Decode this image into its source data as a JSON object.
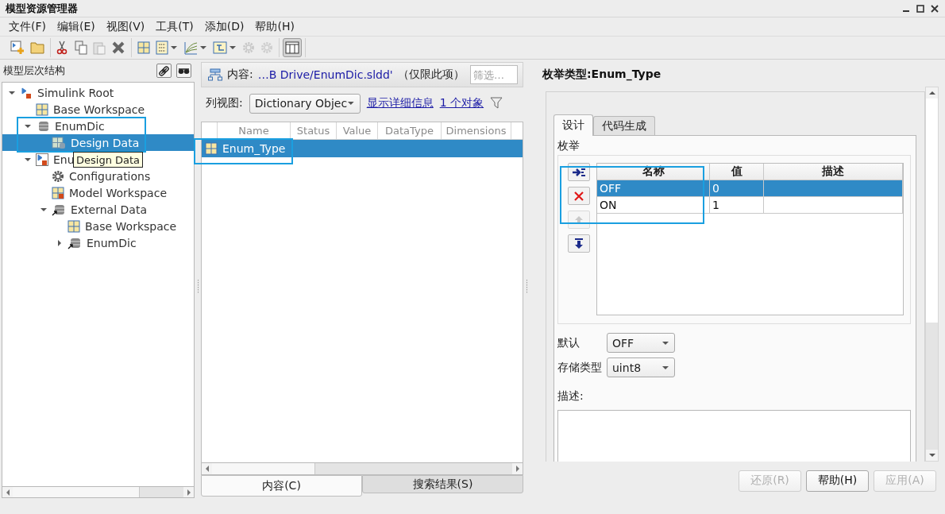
{
  "window": {
    "title": "模型资源管理器"
  },
  "menu": [
    {
      "label": "文件(F)"
    },
    {
      "label": "编辑(E)"
    },
    {
      "label": "视图(V)"
    },
    {
      "label": "工具(T)"
    },
    {
      "label": "添加(D)"
    },
    {
      "label": "帮助(H)"
    }
  ],
  "toolbar": [
    [
      {
        "disabled": false,
        "dropdown": false,
        "pressed": false
      },
      {
        "disabled": false,
        "dropdown": false,
        "pressed": false
      }
    ],
    [
      {
        "disabled": false,
        "dropdown": false,
        "pressed": false
      },
      {
        "disabled": false,
        "dropdown": false,
        "pressed": false
      },
      {
        "disabled": true,
        "dropdown": false,
        "pressed": false
      },
      {
        "disabled": false,
        "dropdown": false,
        "pressed": false
      }
    ],
    [
      {
        "disabled": false,
        "dropdown": false,
        "pressed": false
      },
      {
        "disabled": false,
        "dropdown": true,
        "pressed": false
      },
      {
        "disabled": false,
        "dropdown": true,
        "pressed": false
      },
      {
        "disabled": false,
        "dropdown": true,
        "pressed": false
      },
      {
        "disabled": true,
        "dropdown": false,
        "pressed": false
      },
      {
        "disabled": true,
        "dropdown": false,
        "pressed": false
      }
    ],
    [
      {
        "disabled": false,
        "dropdown": false,
        "pressed": true
      }
    ]
  ],
  "hierarchy": {
    "title": "模型层次结构",
    "tree": [
      {
        "label": "Simulink Root",
        "kind": "root",
        "expanded": true,
        "selected": false,
        "children": [
          {
            "label": "Base Workspace",
            "kind": "workspace",
            "selected": false
          },
          {
            "label": "EnumDic",
            "kind": "dictionary",
            "expanded": true,
            "selected": false,
            "children": [
              {
                "label": "Design Data",
                "kind": "design-data",
                "selected": true
              }
            ]
          },
          {
            "label": "Enu",
            "kind": "model",
            "expanded": true,
            "selected": false,
            "children": [
              {
                "label": "Configurations",
                "kind": "config",
                "selected": false
              },
              {
                "label": "Model Workspace",
                "kind": "model-workspace",
                "selected": false
              },
              {
                "label": "External Data",
                "kind": "external",
                "expanded": true,
                "selected": false,
                "children": [
                  {
                    "label": "Base Workspace",
                    "kind": "workspace",
                    "selected": false
                  },
                  {
                    "label": "EnumDic",
                    "kind": "external",
                    "expanded": false,
                    "selected": false
                  }
                ]
              }
            ]
          }
        ]
      }
    ],
    "tooltip": "Design Data"
  },
  "contents": {
    "label": "内容:",
    "path": "…B Drive/EnumDic.sldd'",
    "scope": "（仅限此项）",
    "filter": {
      "placeholder": "筛选…"
    },
    "view_label": "列视图:",
    "view": "Dictionary Objec",
    "details_link": "显示详细信息",
    "count_link": "1 个对象",
    "columns": [
      "Name",
      "Status",
      "Value",
      "DataType",
      "Dimensions"
    ],
    "rows": [
      {
        "name": "Enum_Type",
        "selected": true
      }
    ],
    "tabs": [
      {
        "label": "内容(C)",
        "selected": true
      },
      {
        "label": "搜索结果(S)",
        "selected": false
      }
    ]
  },
  "editor": {
    "title": "枚举类型:Enum_Type",
    "tabs": [
      {
        "label": "设计",
        "selected": true
      },
      {
        "label": "代码生成",
        "selected": false
      }
    ],
    "group": "枚举",
    "side_buttons": [
      {
        "kind": "add",
        "disabled": false
      },
      {
        "kind": "delete",
        "disabled": false
      },
      {
        "kind": "up",
        "disabled": true
      },
      {
        "kind": "down",
        "disabled": false
      }
    ],
    "columns": [
      "名称",
      "值",
      "描述"
    ],
    "rows": [
      {
        "name": "OFF",
        "value": "0",
        "selected": true
      },
      {
        "name": "ON",
        "value": "1",
        "selected": false
      }
    ],
    "fields": [
      {
        "label": "默认",
        "value": "OFF"
      },
      {
        "label": "存储类型",
        "value": "uint8"
      }
    ],
    "description": {
      "label": "描述:"
    }
  },
  "buttons": [
    {
      "label": "还原(R)",
      "disabled": true
    },
    {
      "label": "帮助(H)",
      "disabled": false
    },
    {
      "label": "应用(A)",
      "disabled": true
    }
  ]
}
